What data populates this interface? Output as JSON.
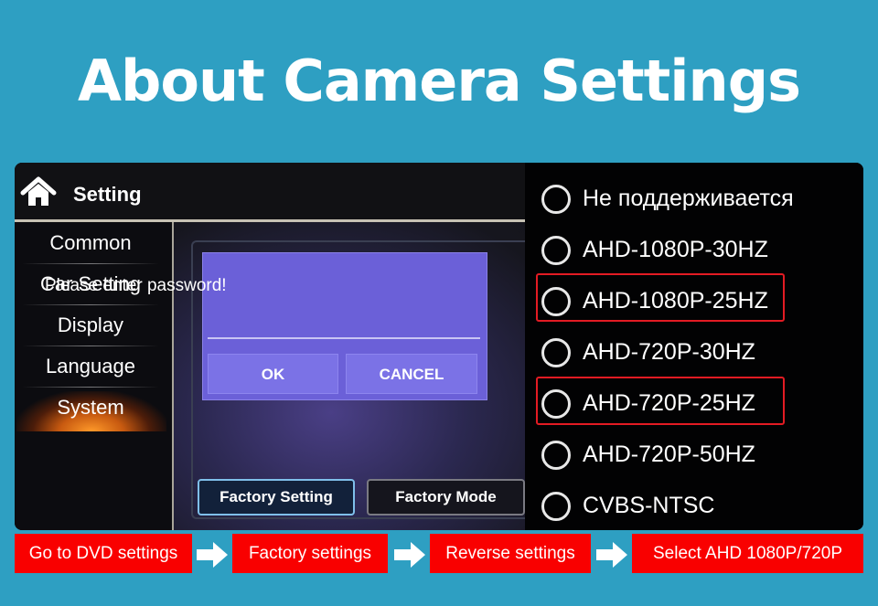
{
  "page_title": "About Camera Settings",
  "header": {
    "icon": "home-icon",
    "title": "Setting"
  },
  "sidebar": {
    "items": [
      {
        "label": "Common"
      },
      {
        "label": "Car Setting"
      },
      {
        "label": "Display"
      },
      {
        "label": "Language"
      },
      {
        "label": "System",
        "selected": true
      }
    ]
  },
  "dialog": {
    "message": "Please enter password!",
    "ok_label": "OK",
    "cancel_label": "CANCEL"
  },
  "bottom_buttons": {
    "factory_setting": "Factory Setting",
    "factory_mode": "Factory Mode"
  },
  "camera_options": [
    {
      "label": "Не поддерживается",
      "highlighted": false
    },
    {
      "label": "AHD-1080P-30HZ",
      "highlighted": false
    },
    {
      "label": "AHD-1080P-25HZ",
      "highlighted": true
    },
    {
      "label": "AHD-720P-30HZ",
      "highlighted": false
    },
    {
      "label": "AHD-720P-25HZ",
      "highlighted": true
    },
    {
      "label": "AHD-720P-50HZ",
      "highlighted": false
    },
    {
      "label": "CVBS-NTSC",
      "highlighted": false
    }
  ],
  "steps": [
    "Go to DVD settings",
    "Factory settings",
    "Reverse settings",
    "Select AHD 1080P/720P"
  ],
  "colors": {
    "background": "#2e9fc2",
    "step_red": "#f90000",
    "highlight_red": "#e31b23",
    "dialog_purple": "#6b60d8"
  }
}
